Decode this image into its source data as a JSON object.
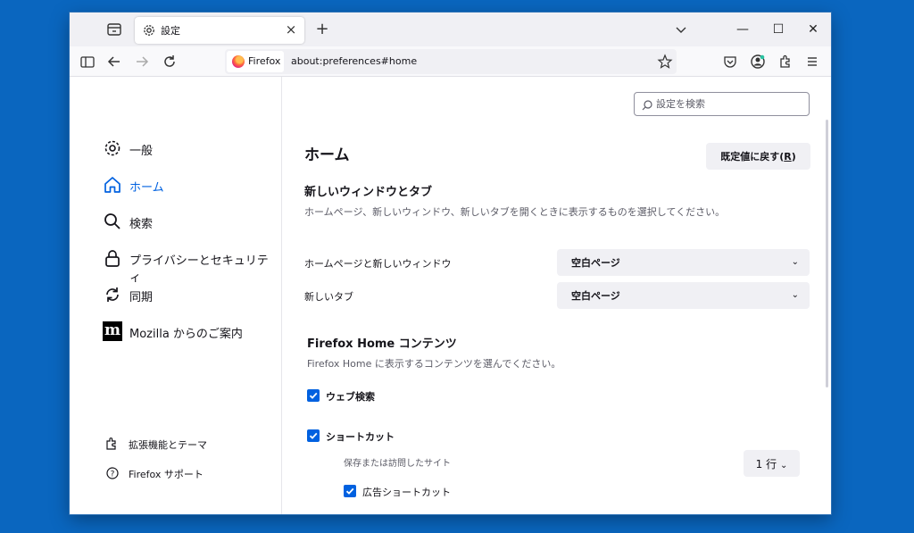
{
  "browser": {
    "tab": {
      "title": "設定",
      "close": "×"
    },
    "new_tab": "+",
    "window_controls": {
      "minimize": "—",
      "maximize": "☐",
      "close": "✕"
    },
    "identity_label": "Firefox",
    "url": "about:preferences#home"
  },
  "sidebar": {
    "categories": [
      {
        "label": "一般",
        "icon": "gear-icon"
      },
      {
        "label": "ホーム",
        "icon": "home-icon",
        "active": true
      },
      {
        "label": "検索",
        "icon": "search-icon"
      },
      {
        "label": "プライバシーとセキュリティ",
        "icon": "lock-icon"
      },
      {
        "label": "同期",
        "icon": "sync-icon"
      },
      {
        "label": "Mozilla からのご案内",
        "icon": "mozilla-icon",
        "icon_text": "m"
      }
    ],
    "footer": [
      {
        "label": "拡張機能とテーマ",
        "icon": "puzzle-icon"
      },
      {
        "label": "Firefox サポート",
        "icon": "help-icon"
      }
    ]
  },
  "main": {
    "search_placeholder": "設定を検索",
    "title": "ホーム",
    "restore_button": {
      "label": "既定値に戻す",
      "accesskey": "R"
    },
    "new_windows": {
      "title": "新しいウィンドウとタブ",
      "description": "ホームページ、新しいウィンドウ、新しいタブを開くときに表示するものを選択してください。",
      "homepage_label": "ホームページと新しいウィンドウ",
      "homepage_value": "空白ページ",
      "newtab_label": "新しいタブ",
      "newtab_value": "空白ページ"
    },
    "home_content": {
      "title": "Firefox Home コンテンツ",
      "description": "Firefox Home に表示するコンテンツを選んでください。",
      "web_search": {
        "label": "ウェブ検索",
        "checked": true
      },
      "shortcuts": {
        "label": "ショートカット",
        "checked": true
      },
      "shortcuts_desc": "保存または訪問したサイト",
      "rows_value": "1 行",
      "sponsored": {
        "label": "広告ショートカット",
        "checked": true
      }
    }
  },
  "colors": {
    "accent": "#0061e0",
    "desktop": "#0a66bf"
  }
}
